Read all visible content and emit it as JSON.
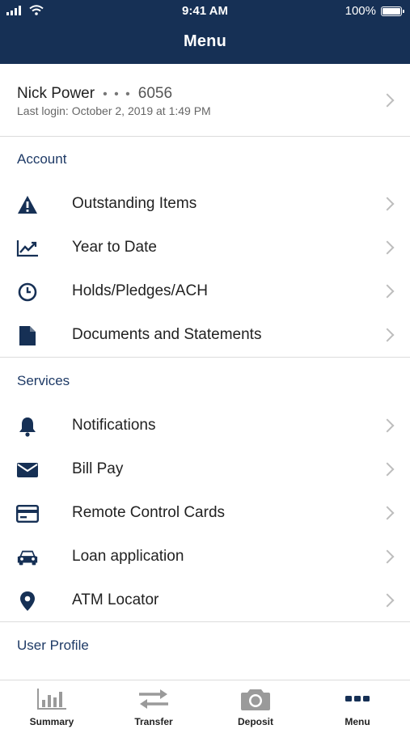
{
  "status": {
    "time": "9:41 AM",
    "battery": "100%"
  },
  "header": {
    "title": "Menu"
  },
  "profile": {
    "name": "Nick Power",
    "masked": "• • •",
    "account_suffix": "6056",
    "last_login": "Last login: October 2, 2019 at 1:49 PM"
  },
  "account": {
    "title": "Account",
    "items": [
      {
        "label": "Outstanding Items",
        "icon": "warning-icon"
      },
      {
        "label": "Year to Date",
        "icon": "chart-line-icon"
      },
      {
        "label": "Holds/Pledges/ACH",
        "icon": "clock-icon"
      },
      {
        "label": "Documents and Statements",
        "icon": "document-icon"
      }
    ]
  },
  "services": {
    "title": "Services",
    "items": [
      {
        "label": "Notifications",
        "icon": "bell-icon"
      },
      {
        "label": "Bill Pay",
        "icon": "envelope-icon"
      },
      {
        "label": "Remote Control Cards",
        "icon": "card-icon"
      },
      {
        "label": "Loan application",
        "icon": "car-icon"
      },
      {
        "label": "ATM Locator",
        "icon": "map-pin-icon"
      }
    ]
  },
  "user_profile": {
    "title": "User Profile"
  },
  "tabs": [
    {
      "label": "Summary",
      "icon": "bar-chart-icon",
      "color": "#9a9a9a"
    },
    {
      "label": "Transfer",
      "icon": "transfer-arrows-icon",
      "color": "#9a9a9a"
    },
    {
      "label": "Deposit",
      "icon": "camera-icon",
      "color": "#9a9a9a"
    },
    {
      "label": "Menu",
      "icon": "more-dots-icon",
      "color": "#163055"
    }
  ],
  "colors": {
    "brand": "#163055",
    "section_text": "#1e3a66",
    "chevron": "#bdbdbd"
  }
}
